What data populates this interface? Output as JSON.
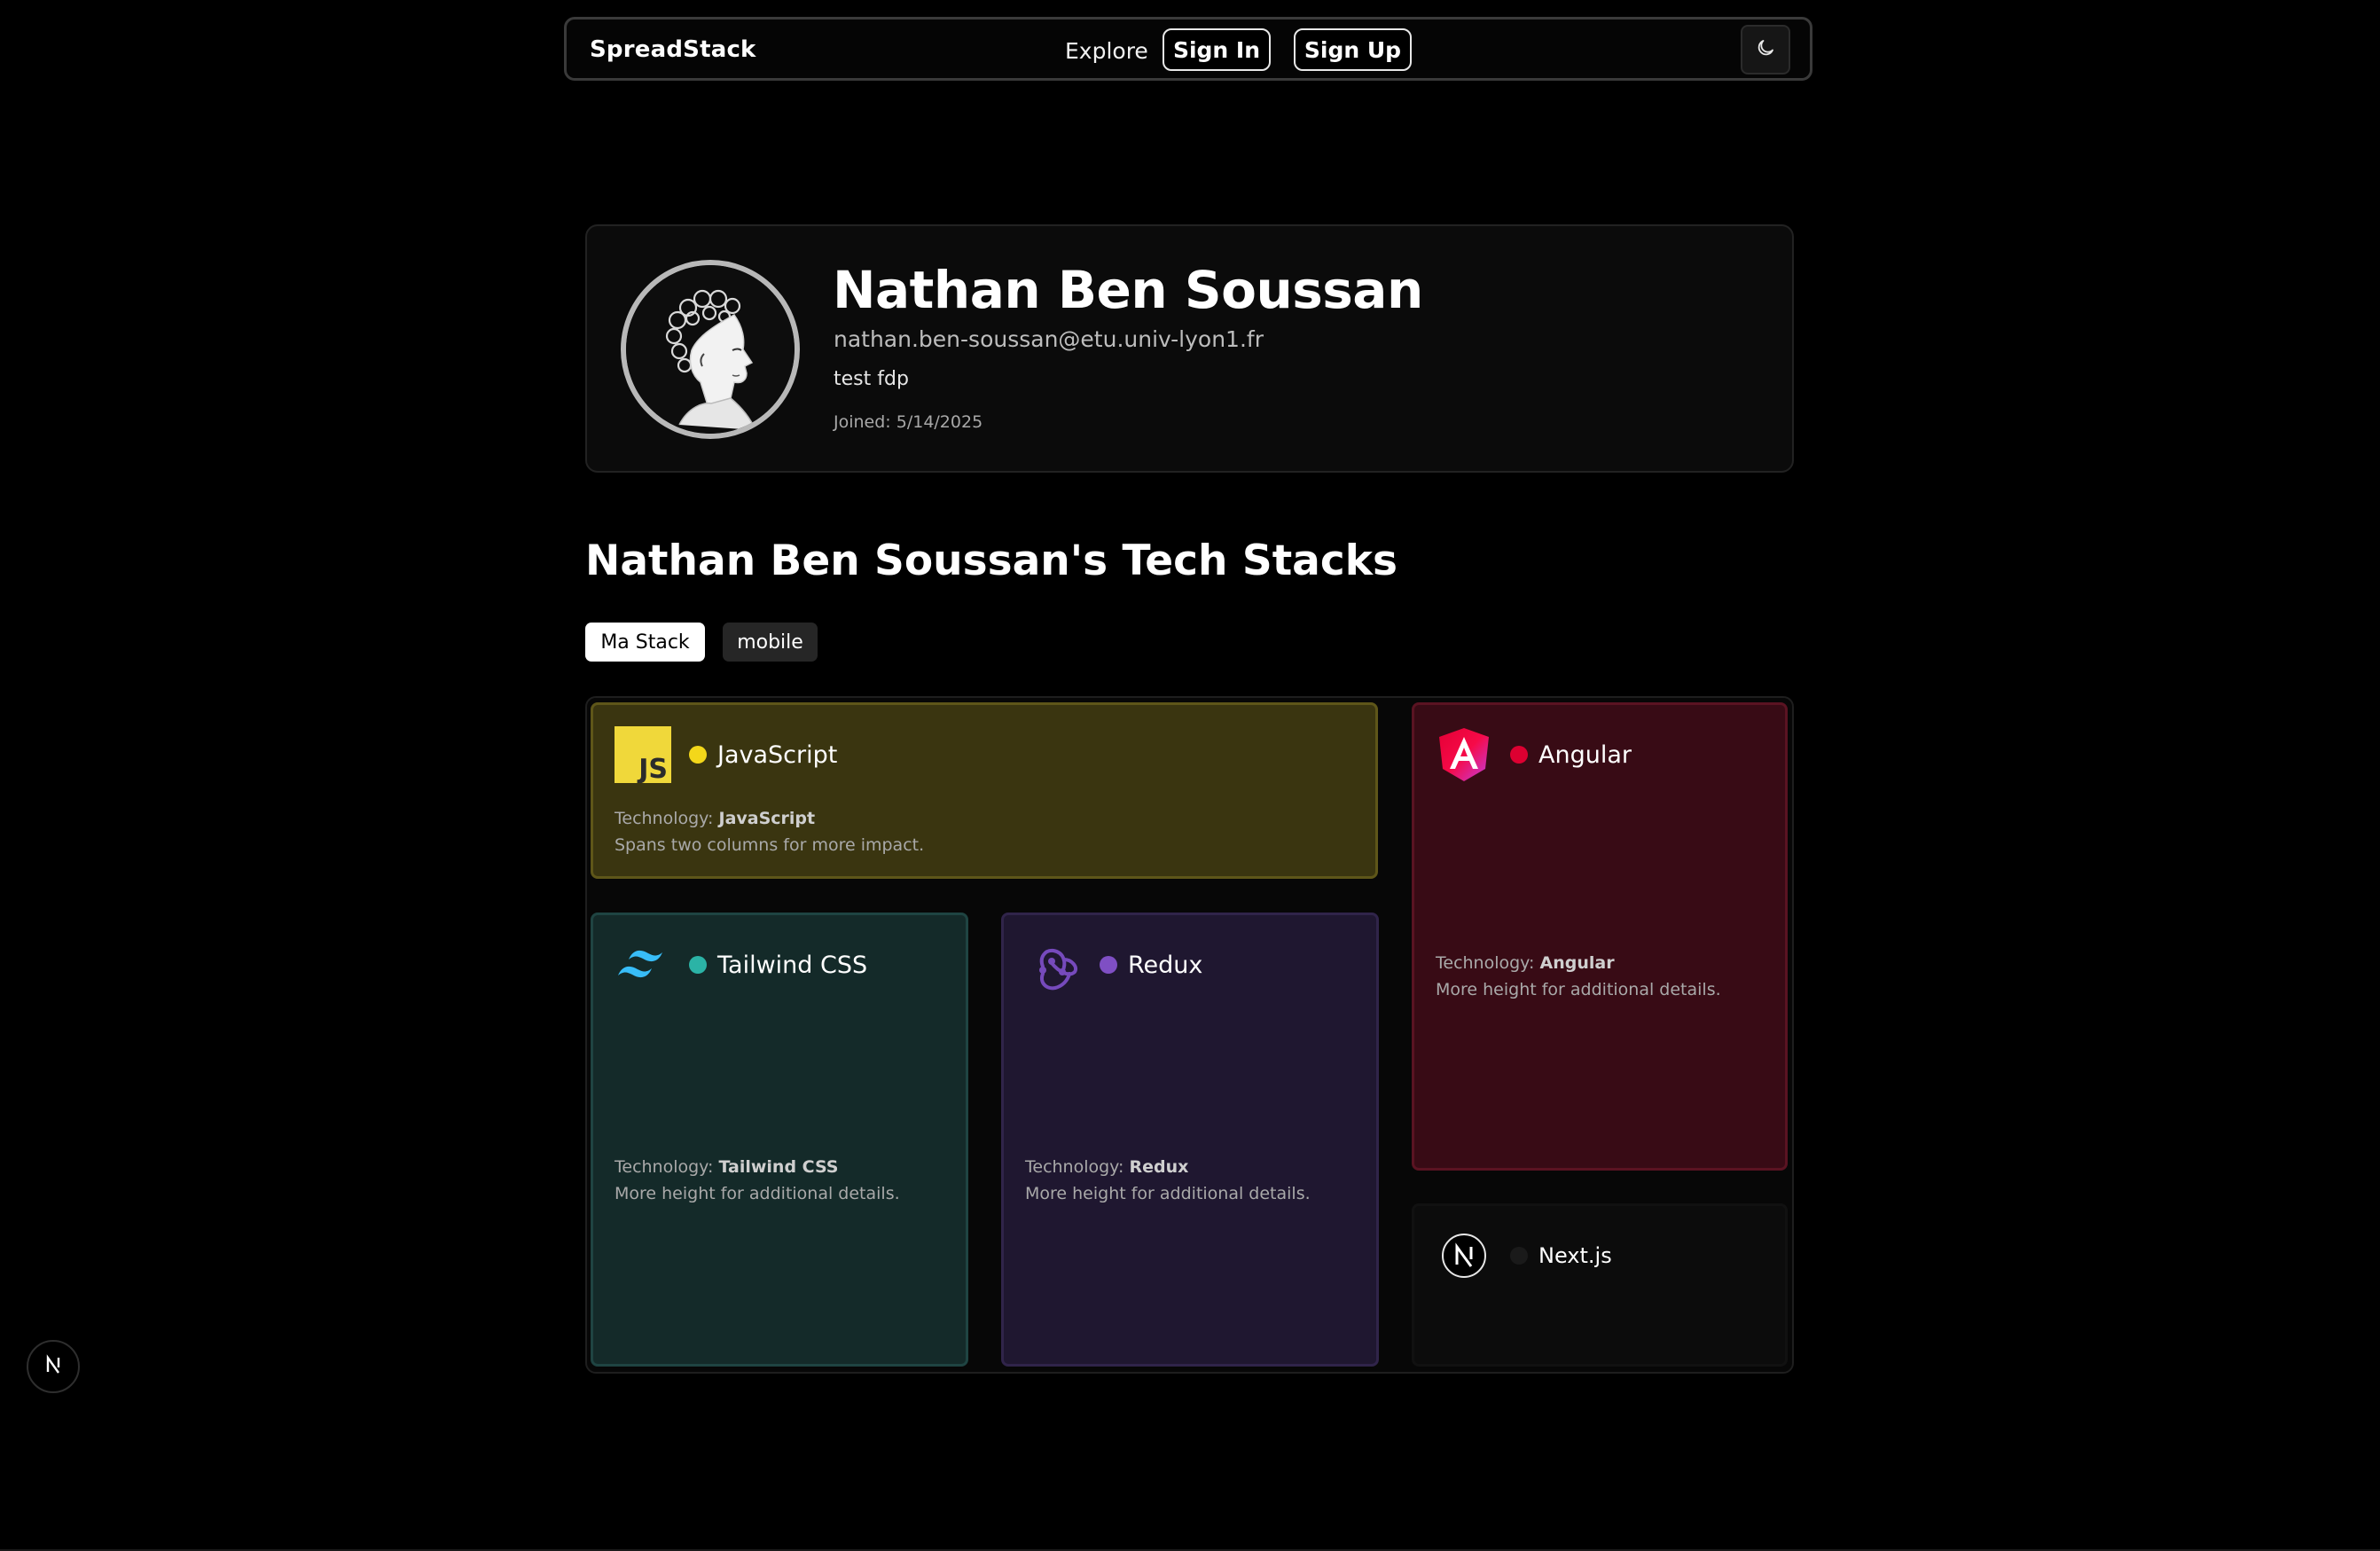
{
  "navbar": {
    "brand": "SpreadStack",
    "explore": "Explore",
    "sign_in": "Sign In",
    "sign_up": "Sign Up",
    "theme_icon": "moon-icon"
  },
  "profile": {
    "name": "Nathan Ben Soussan",
    "email": "nathan.ben-soussan@etu.univ-lyon1.fr",
    "bio": "test fdp",
    "joined": "Joined: 5/14/2025"
  },
  "stacks": {
    "title": "Nathan Ben Soussan's Tech Stacks",
    "tabs": [
      {
        "label": "Ma Stack",
        "active": true
      },
      {
        "label": "mobile",
        "active": false
      }
    ],
    "tech_prefix": "Technology: ",
    "cards": [
      {
        "name": "JavaScript",
        "dot_color": "#f3d71a",
        "tech": "JavaScript",
        "desc": "Spans two columns for more impact.",
        "icon": "javascript-icon"
      },
      {
        "name": "Tailwind CSS",
        "dot_color": "#2bb3a6",
        "tech": "Tailwind CSS",
        "desc": "More height for additional details.",
        "icon": "tailwind-icon"
      },
      {
        "name": "Redux",
        "dot_color": "#7f4fc4",
        "tech": "Redux",
        "desc": "More height for additional details.",
        "icon": "redux-icon"
      },
      {
        "name": "Angular",
        "dot_color": "#dd0031",
        "tech": "Angular",
        "desc": "More height for additional details.",
        "icon": "angular-icon"
      },
      {
        "name": "Next.js",
        "dot_color": "#1a1a1a",
        "icon": "nextjs-icon"
      }
    ]
  },
  "dev_badge": {
    "icon": "nextjs-icon"
  }
}
